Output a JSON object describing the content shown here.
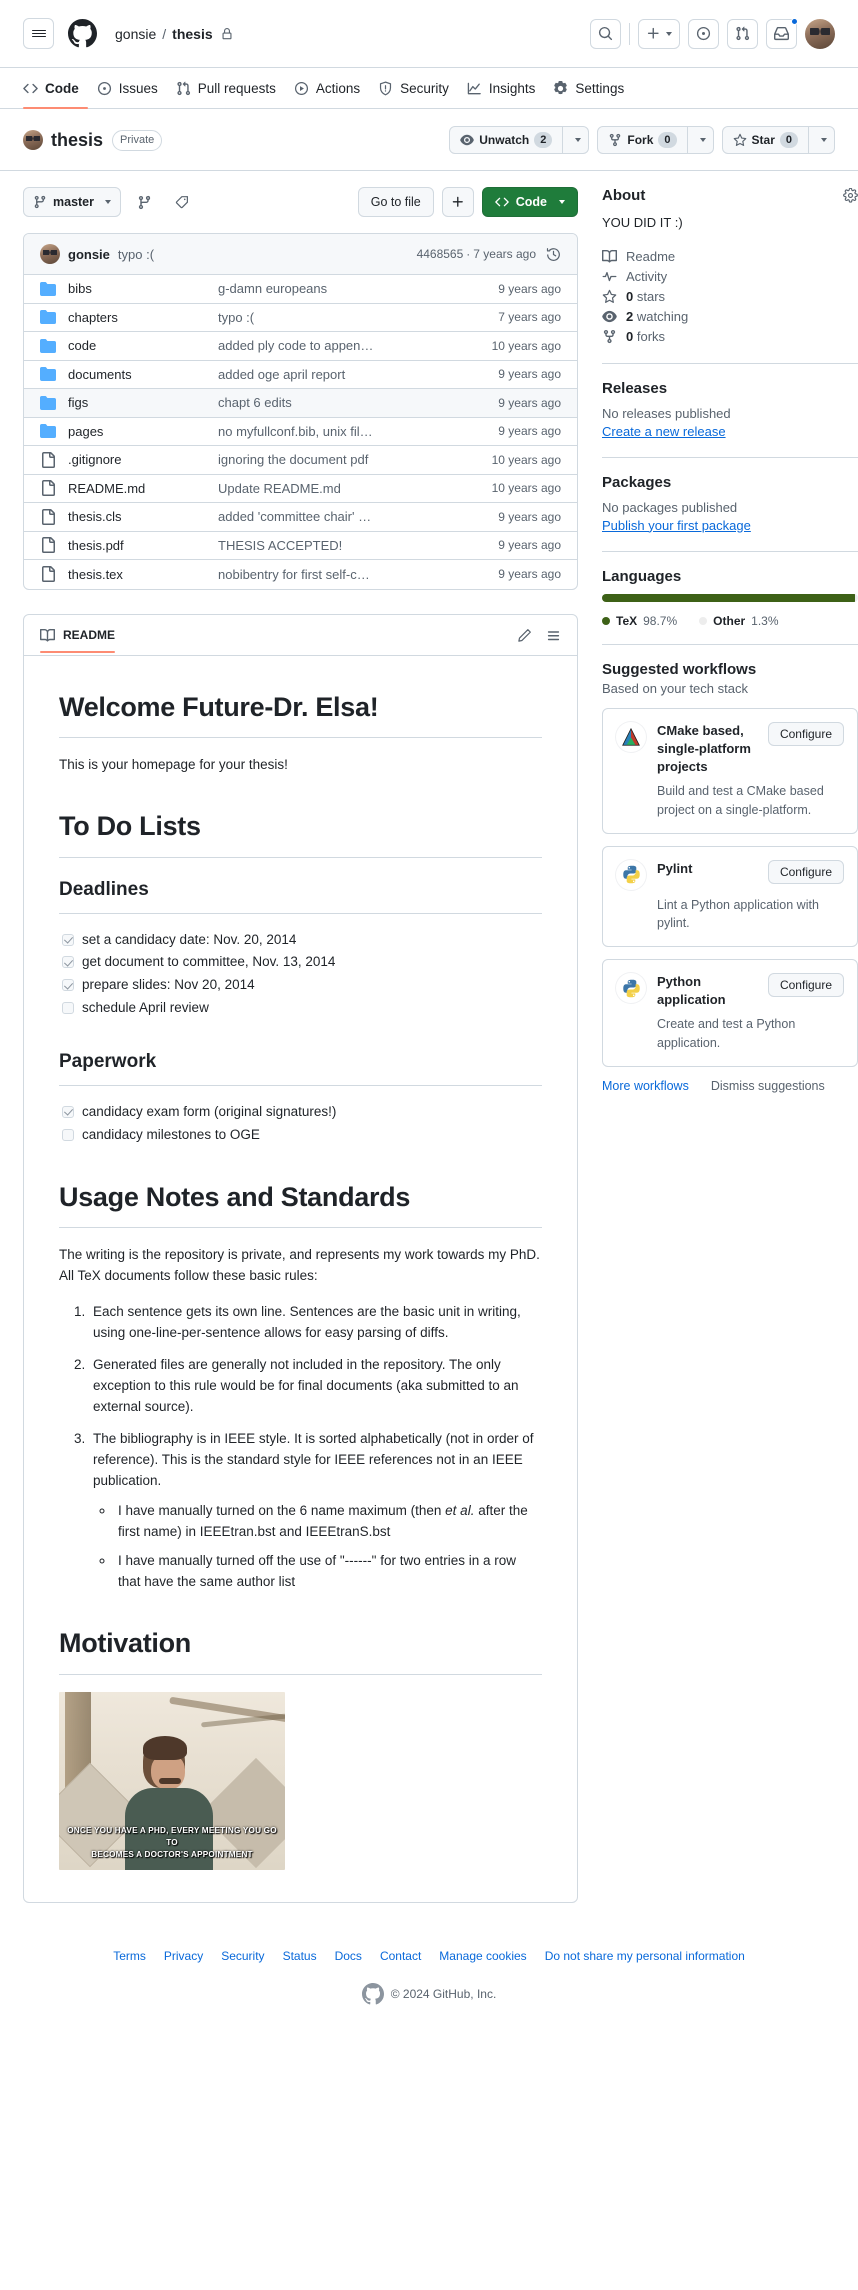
{
  "header": {
    "owner": "gonsie",
    "separator": "/",
    "repo": "thesis",
    "icons": {
      "menu": "hamburger-icon",
      "logo": "github-logo-icon",
      "lock": "lock-icon",
      "search": "search-icon",
      "create": "plus-icon",
      "issues": "issue-opened-icon",
      "pull_requests": "git-pull-request-icon",
      "inbox": "inbox-icon",
      "avatar": "user-avatar"
    }
  },
  "repo_nav": {
    "tabs": [
      {
        "label": "Code",
        "icon": "code-icon",
        "active": true
      },
      {
        "label": "Issues",
        "icon": "issue-opened-icon",
        "active": false
      },
      {
        "label": "Pull requests",
        "icon": "git-pull-request-icon",
        "active": false
      },
      {
        "label": "Actions",
        "icon": "play-icon",
        "active": false
      },
      {
        "label": "Security",
        "icon": "shield-icon",
        "active": false
      },
      {
        "label": "Insights",
        "icon": "graph-icon",
        "active": false
      },
      {
        "label": "Settings",
        "icon": "gear-icon",
        "active": false
      }
    ]
  },
  "repo_title": {
    "name": "thesis",
    "visibility": "Private",
    "watch": {
      "label": "Unwatch",
      "count": "2"
    },
    "fork": {
      "label": "Fork",
      "count": "0"
    },
    "star": {
      "label": "Star",
      "count": "0"
    }
  },
  "file_toolbar": {
    "branch": "master",
    "branches_icon": "git-branch-icon",
    "tags_icon": "tag-icon",
    "go_to_file": "Go to file",
    "add_file": "+",
    "code_button": "Code"
  },
  "latest_commit": {
    "author": "gonsie",
    "message": "typo :(",
    "sha": "4468565",
    "sha_separator": "·",
    "age": "7 years ago",
    "history_icon": "history-icon"
  },
  "files": [
    {
      "name": "bibs",
      "type": "dir",
      "message": "g-damn europeans",
      "age": "9 years ago",
      "hovered": false
    },
    {
      "name": "chapters",
      "type": "dir",
      "message": "typo :(",
      "age": "7 years ago",
      "hovered": false
    },
    {
      "name": "code",
      "type": "dir",
      "message": "added ply code to appen…",
      "age": "10 years ago",
      "hovered": false
    },
    {
      "name": "documents",
      "type": "dir",
      "message": "added oge april report",
      "age": "9 years ago",
      "hovered": false
    },
    {
      "name": "figs",
      "type": "dir",
      "message": "chapt 6 edits",
      "age": "9 years ago",
      "hovered": true
    },
    {
      "name": "pages",
      "type": "dir",
      "message": "no myfullconf.bib, unix fil…",
      "age": "9 years ago",
      "hovered": false
    },
    {
      "name": ".gitignore",
      "type": "file",
      "message": "ignoring the document pdf",
      "age": "10 years ago",
      "hovered": false
    },
    {
      "name": "README.md",
      "type": "file",
      "message": "Update README.md",
      "age": "10 years ago",
      "hovered": false
    },
    {
      "name": "thesis.cls",
      "type": "file",
      "message": "added 'committee chair' …",
      "age": "9 years ago",
      "hovered": false
    },
    {
      "name": "thesis.pdf",
      "type": "file",
      "message": "THESIS ACCEPTED!",
      "age": "9 years ago",
      "hovered": false
    },
    {
      "name": "thesis.tex",
      "type": "file",
      "message": "nobibentry for first self-c…",
      "age": "9 years ago",
      "hovered": false
    }
  ],
  "readme": {
    "tab_label": "README",
    "edit_icon": "pencil-icon",
    "outline_icon": "list-unordered-icon",
    "h1_welcome": "Welcome Future-Dr. Elsa!",
    "p_intro": "This is your homepage for your thesis!",
    "h1_todo": "To Do Lists",
    "h2_deadlines": "Deadlines",
    "deadlines": [
      {
        "text": "set a candidacy date: Nov. 20, 2014",
        "checked": true
      },
      {
        "text": "get document to committee, Nov. 13, 2014",
        "checked": true
      },
      {
        "text": "prepare slides: Nov 20, 2014",
        "checked": true
      },
      {
        "text": "schedule April review",
        "checked": false
      }
    ],
    "h2_paperwork": "Paperwork",
    "paperwork": [
      {
        "text": "candidacy exam form (original signatures!)",
        "checked": true
      },
      {
        "text": "candidacy milestones to OGE",
        "checked": false
      }
    ],
    "h1_usage": "Usage Notes and Standards",
    "p_usage": "The writing is the repository is private, and represents my work towards my PhD. All TeX documents follow these basic rules:",
    "rules": [
      "Each sentence gets its own line. Sentences are the basic unit in writing, using one-line-per-sentence allows for easy parsing of diffs.",
      "Generated files are generally not included in the repository. The only exception to this rule would be for final documents (aka submitted to an external source).",
      "The bibliography is in IEEE style. It is sorted alphabetically (not in order of reference). This is the standard style for IEEE references not in an IEEE publication."
    ],
    "subrules": [
      {
        "pre": "I have manually turned on the 6 name maximum (then ",
        "em": "et al.",
        "post": " after the first name) in IEEEtran.bst and IEEEtranS.bst"
      },
      {
        "pre": "I have manually turned off the use of \"------\" for two entries in a row that have the same author list",
        "em": "",
        "post": ""
      }
    ],
    "h1_motivation": "Motivation",
    "image_caption_line1": "Once you have a PhD, every meeting you go to",
    "image_caption_line2": "becomes a doctor's appointment"
  },
  "sidebar": {
    "about": {
      "title": "About",
      "gear_icon": "gear-icon",
      "description": "YOU DID IT :)",
      "links": [
        {
          "label": "Readme",
          "icon": "book-icon",
          "bold": ""
        },
        {
          "label": "Activity",
          "icon": "pulse-icon",
          "bold": ""
        },
        {
          "label": "stars",
          "icon": "star-icon",
          "bold": "0"
        },
        {
          "label": "watching",
          "icon": "eye-icon",
          "bold": "2"
        },
        {
          "label": "forks",
          "icon": "repo-forked-icon",
          "bold": "0"
        }
      ]
    },
    "releases": {
      "title": "Releases",
      "empty": "No releases published",
      "link": "Create a new release"
    },
    "packages": {
      "title": "Packages",
      "empty": "No packages published",
      "link": "Publish your first package"
    },
    "languages": {
      "title": "Languages",
      "items": [
        {
          "name": "TeX",
          "percent": "98.7%",
          "color": "#3D6117",
          "width": 98.7
        },
        {
          "name": "Other",
          "percent": "1.3%",
          "color": "#ededed",
          "width": 1.3
        }
      ]
    },
    "workflows": {
      "title": "Suggested workflows",
      "subtitle": "Based on your tech stack",
      "cards": [
        {
          "name": "CMake based, single-platform projects",
          "description": "Build and test a CMake based project on a single-platform.",
          "button": "Configure",
          "icon": "cmake-icon"
        },
        {
          "name": "Pylint",
          "description": "Lint a Python application with pylint.",
          "button": "Configure",
          "icon": "python-icon"
        },
        {
          "name": "Python application",
          "description": "Create and test a Python application.",
          "button": "Configure",
          "icon": "python-icon"
        }
      ],
      "more_link": "More workflows",
      "dismiss_link": "Dismiss suggestions"
    }
  },
  "footer": {
    "links": [
      "Terms",
      "Privacy",
      "Security",
      "Status",
      "Docs",
      "Contact",
      "Manage cookies",
      "Do not share my personal information"
    ],
    "copyright": "© 2024 GitHub, Inc.",
    "logo_icon": "github-logo-icon"
  }
}
